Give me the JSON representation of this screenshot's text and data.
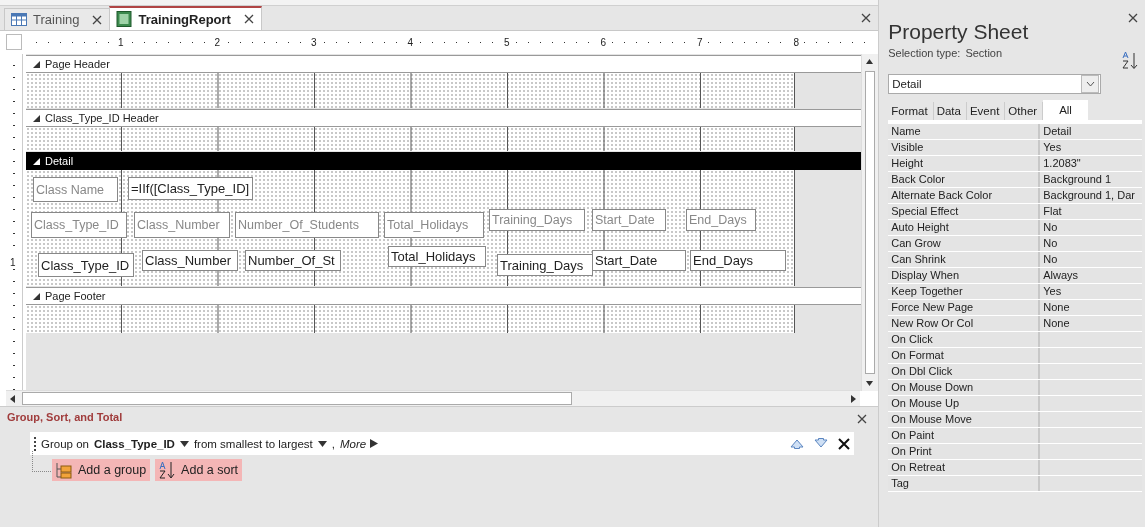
{
  "document_tabs": [
    {
      "label": "Training",
      "kind": "table",
      "selected": false
    },
    {
      "label": "TrainingReport",
      "kind": "report",
      "selected": true
    }
  ],
  "ruler": {
    "marks": [
      "1",
      "2",
      "3",
      "4",
      "5",
      "6",
      "7",
      "8"
    ]
  },
  "vertical_ruler": {
    "marks": [
      "1"
    ]
  },
  "sections": [
    {
      "title": "Page Header",
      "selected": false
    },
    {
      "title": "Class_Type_ID Header",
      "selected": false
    },
    {
      "title": "Detail",
      "selected": true,
      "controls": [
        {
          "kind": "label",
          "text": "Class Name"
        },
        {
          "kind": "textbox",
          "text": "=IIf([Class_Type_ID]"
        },
        {
          "kind": "label",
          "text": "Class_Type_ID"
        },
        {
          "kind": "label",
          "text": "Class_Number"
        },
        {
          "kind": "label",
          "text": "Number_Of_Students"
        },
        {
          "kind": "label",
          "text": "Total_Holidays"
        },
        {
          "kind": "label",
          "text": "Training_Days"
        },
        {
          "kind": "label",
          "text": "Start_Date"
        },
        {
          "kind": "label",
          "text": "End_Days"
        },
        {
          "kind": "textbox",
          "text": "Class_Type_ID"
        },
        {
          "kind": "textbox",
          "text": "Class_Number"
        },
        {
          "kind": "textbox",
          "text": "Number_Of_St"
        },
        {
          "kind": "textbox",
          "text": "Total_Holidays"
        },
        {
          "kind": "textbox",
          "text": "Training_Days"
        },
        {
          "kind": "textbox",
          "text": "Start_Date"
        },
        {
          "kind": "textbox",
          "text": "End_Days"
        }
      ]
    },
    {
      "title": "Page Footer",
      "selected": false
    }
  ],
  "group_sort_total": {
    "title": "Group, Sort, and Total",
    "group_row": {
      "prefix": "Group on",
      "field": "Class_Type_ID",
      "order": "from smallest to largest",
      "separator": ",",
      "more": "More"
    },
    "buttons": [
      {
        "label": "Add a group",
        "kind": "group"
      },
      {
        "label": "Add a sort",
        "kind": "sort"
      }
    ]
  },
  "property_sheet": {
    "title": "Property Sheet",
    "selection_type_label": "Selection type:",
    "selection_type": "Section",
    "object_selector": "Detail",
    "tabs": [
      {
        "label": "Format",
        "selected": false
      },
      {
        "label": "Data",
        "selected": false
      },
      {
        "label": "Event",
        "selected": false
      },
      {
        "label": "Other",
        "selected": false
      },
      {
        "label": "All",
        "selected": true
      }
    ],
    "properties": [
      {
        "name": "Name",
        "value": "Detail"
      },
      {
        "name": "Visible",
        "value": "Yes"
      },
      {
        "name": "Height",
        "value": "1.2083\""
      },
      {
        "name": "Back Color",
        "value": "Background 1"
      },
      {
        "name": "Alternate Back Color",
        "value": "Background 1, Dar"
      },
      {
        "name": "Special Effect",
        "value": "Flat"
      },
      {
        "name": "Auto Height",
        "value": "No"
      },
      {
        "name": "Can Grow",
        "value": "No"
      },
      {
        "name": "Can Shrink",
        "value": "No"
      },
      {
        "name": "Display When",
        "value": "Always"
      },
      {
        "name": "Keep Together",
        "value": "Yes"
      },
      {
        "name": "Force New Page",
        "value": "None"
      },
      {
        "name": "New Row Or Col",
        "value": "None"
      },
      {
        "name": "On Click"
      },
      {
        "name": "On Format"
      },
      {
        "name": "On Dbl Click"
      },
      {
        "name": "On Mouse Down"
      },
      {
        "name": "On Mouse Up"
      },
      {
        "name": "On Mouse Move"
      },
      {
        "name": "On Paint"
      },
      {
        "name": "On Print"
      },
      {
        "name": "On Retreat"
      },
      {
        "name": "Tag"
      }
    ]
  }
}
